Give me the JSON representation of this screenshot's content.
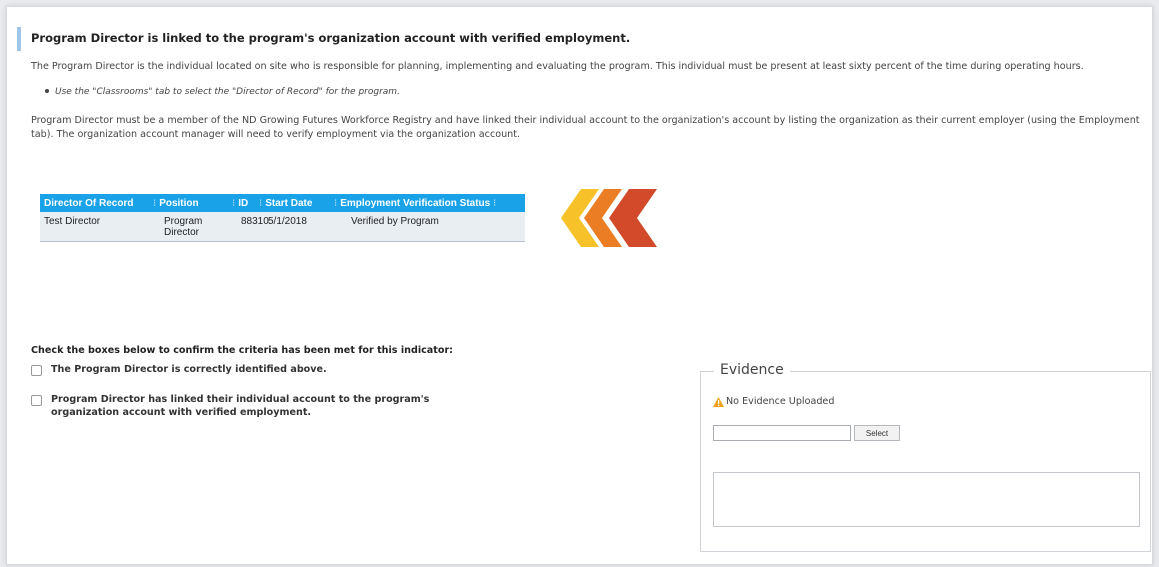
{
  "indicator": {
    "heading": "Program Director is linked to the program's organization account with verified employment.",
    "paragraph1": "The Program Director is the individual located on site who is responsible for planning, implementing and evaluating the program. This individual must be present at least sixty percent of the time during operating hours.",
    "bullet": "Use the \"Classrooms\" tab to select the \"Director of Record\" for the program.",
    "paragraph2": "Program Director must be a member of the ND Growing Futures Workforce Registry and have linked their individual account to the organization's account by listing the organization as their current employer (using the Employment tab). The organization account manager will need to verify employment via the organization account."
  },
  "director_table": {
    "columns": [
      "Director Of Record",
      "Position",
      "ID",
      "Start Date",
      "Employment Verification Status"
    ],
    "rows": [
      {
        "director": "Test Director",
        "position": "Program Director",
        "id": "88310",
        "start_date": "5/1/2018",
        "status": "Verified by Program"
      }
    ],
    "header_color": "#1aa2e8"
  },
  "arrows": {
    "icon": "chevron-arrows-icon",
    "colors": [
      "#f7c12a",
      "#eb7e24",
      "#d24a29"
    ]
  },
  "checklist": {
    "heading": "Check the boxes below to confirm the criteria has been met for this indicator:",
    "items": [
      {
        "label": "The Program Director is correctly identified above.",
        "checked": false
      },
      {
        "label": "Program Director has linked their individual account to the program's organization account with verified employment.",
        "checked": false
      }
    ]
  },
  "evidence": {
    "legend": "Evidence",
    "status": "No Evidence Uploaded",
    "status_icon": "warning-icon",
    "file_value": "",
    "select_label": "Select",
    "notes_value": ""
  }
}
